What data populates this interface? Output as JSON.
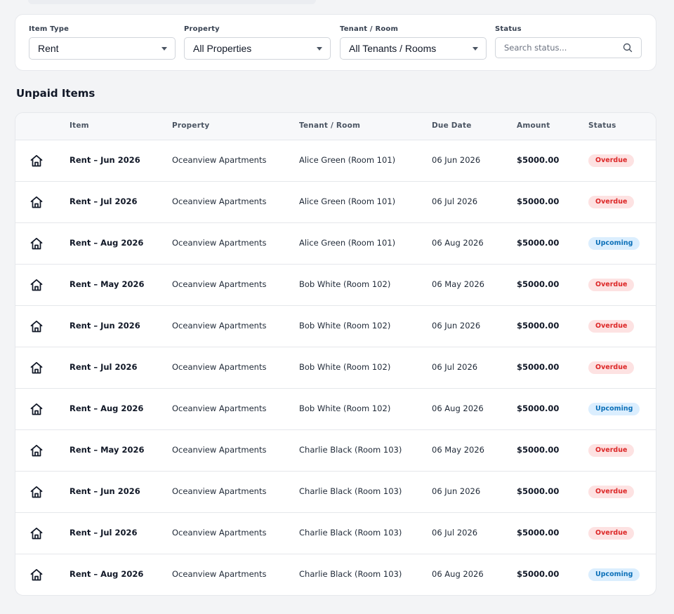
{
  "filters": {
    "item_type": {
      "label": "Item Type",
      "value": "Rent"
    },
    "property": {
      "label": "Property",
      "value": "All Properties"
    },
    "tenant_room": {
      "label": "Tenant / Room",
      "value": "All Tenants / Rooms"
    },
    "status": {
      "label": "Status",
      "placeholder": "Search status..."
    }
  },
  "section_title": "Unpaid Items",
  "table": {
    "headers": {
      "item": "Item",
      "property": "Property",
      "tenant_room": "Tenant / Room",
      "due_date": "Due Date",
      "amount": "Amount",
      "status": "Status"
    },
    "row_icon": "home-icon",
    "rows": [
      {
        "item": "Rent – Jun 2026",
        "property": "Oceanview Apartments",
        "tenant_room": "Alice Green (Room 101)",
        "due_date": "06 Jun 2026",
        "amount": "$5000.00",
        "status": "Overdue"
      },
      {
        "item": "Rent – Jul 2026",
        "property": "Oceanview Apartments",
        "tenant_room": "Alice Green (Room 101)",
        "due_date": "06 Jul 2026",
        "amount": "$5000.00",
        "status": "Overdue"
      },
      {
        "item": "Rent – Aug 2026",
        "property": "Oceanview Apartments",
        "tenant_room": "Alice Green (Room 101)",
        "due_date": "06 Aug 2026",
        "amount": "$5000.00",
        "status": "Upcoming"
      },
      {
        "item": "Rent – May 2026",
        "property": "Oceanview Apartments",
        "tenant_room": "Bob White (Room 102)",
        "due_date": "06 May 2026",
        "amount": "$5000.00",
        "status": "Overdue"
      },
      {
        "item": "Rent – Jun 2026",
        "property": "Oceanview Apartments",
        "tenant_room": "Bob White (Room 102)",
        "due_date": "06 Jun 2026",
        "amount": "$5000.00",
        "status": "Overdue"
      },
      {
        "item": "Rent – Jul 2026",
        "property": "Oceanview Apartments",
        "tenant_room": "Bob White (Room 102)",
        "due_date": "06 Jul 2026",
        "amount": "$5000.00",
        "status": "Overdue"
      },
      {
        "item": "Rent – Aug 2026",
        "property": "Oceanview Apartments",
        "tenant_room": "Bob White (Room 102)",
        "due_date": "06 Aug 2026",
        "amount": "$5000.00",
        "status": "Upcoming"
      },
      {
        "item": "Rent – May 2026",
        "property": "Oceanview Apartments",
        "tenant_room": "Charlie Black (Room 103)",
        "due_date": "06 May 2026",
        "amount": "$5000.00",
        "status": "Overdue"
      },
      {
        "item": "Rent – Jun 2026",
        "property": "Oceanview Apartments",
        "tenant_room": "Charlie Black (Room 103)",
        "due_date": "06 Jun 2026",
        "amount": "$5000.00",
        "status": "Overdue"
      },
      {
        "item": "Rent – Jul 2026",
        "property": "Oceanview Apartments",
        "tenant_room": "Charlie Black (Room 103)",
        "due_date": "06 Jul 2026",
        "amount": "$5000.00",
        "status": "Overdue"
      },
      {
        "item": "Rent – Aug 2026",
        "property": "Oceanview Apartments",
        "tenant_room": "Charlie Black (Room 103)",
        "due_date": "06 Aug 2026",
        "amount": "$5000.00",
        "status": "Upcoming"
      }
    ]
  },
  "colors": {
    "overdue_bg": "#fde2e2",
    "overdue_text": "#dc2626",
    "upcoming_bg": "#dbeefe",
    "upcoming_text": "#0b6fb8"
  }
}
